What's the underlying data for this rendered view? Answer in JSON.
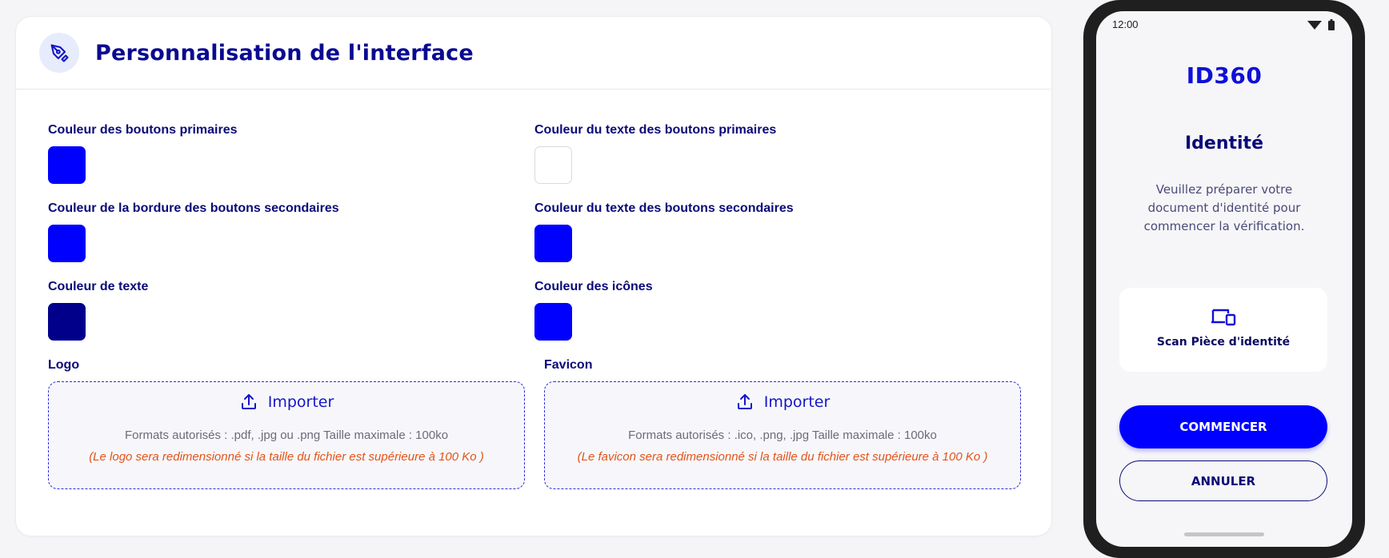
{
  "panel": {
    "title": "Personnalisation de l'interface",
    "icon": "pen-nib-icon"
  },
  "colors": [
    {
      "label": "Couleur des boutons primaires",
      "value": "#0000ff"
    },
    {
      "label": "Couleur du texte des boutons primaires",
      "value": "#ffffff"
    },
    {
      "label": "Couleur de la bordure des boutons secondaires",
      "value": "#0000ff"
    },
    {
      "label": "Couleur du texte des boutons secondaires",
      "value": "#0000ff"
    },
    {
      "label": "Couleur de texte",
      "value": "#00008b"
    },
    {
      "label": "Couleur des icônes",
      "value": "#0000ff"
    }
  ],
  "logo": {
    "label": "Logo",
    "import_label": "Importer",
    "formats": "Formats autorisés : .pdf, .jpg ou .png Taille maximale : 100ko",
    "note": "(Le logo sera redimensionné si la taille du fichier est supérieure à 100 Ko )"
  },
  "favicon": {
    "label": "Favicon",
    "import_label": "Importer",
    "formats": "Formats autorisés : .ico, .png, .jpg Taille maximale : 100ko",
    "note": "(Le favicon sera redimensionné si la taille du fichier est supérieure à 100 Ko )"
  },
  "preview": {
    "time": "12:00",
    "brand": "ID360",
    "title": "Identité",
    "description": "Veuillez préparer votre document d'identité pour commencer la vérification.",
    "scan_label": "Scan Pièce d'identité",
    "start_button": "COMMENCER",
    "cancel_button": "ANNULER"
  }
}
